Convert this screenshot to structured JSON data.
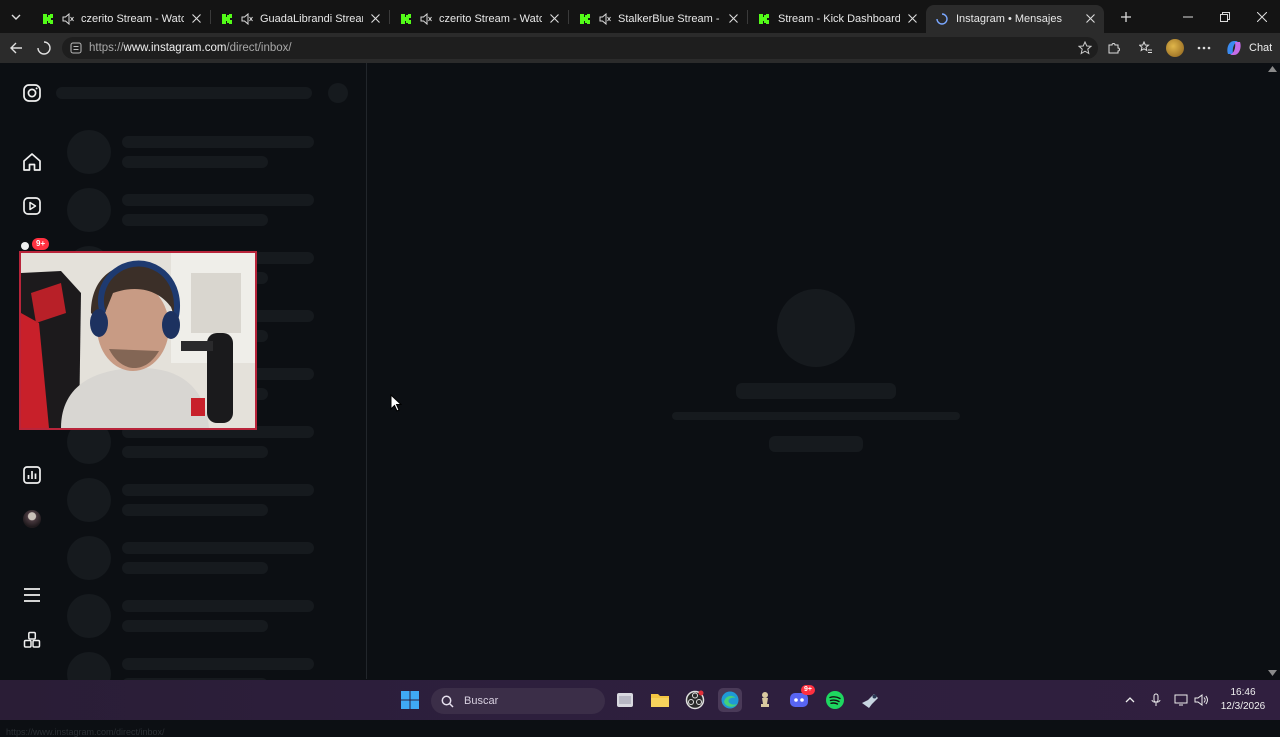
{
  "browser": {
    "tabs": [
      {
        "title": "czerito Stream - Watch Live",
        "favicon": "kick-logo-icon",
        "muted": true
      },
      {
        "title": "GuadaLibrandi Stream - Watch",
        "favicon": "kick-logo-icon",
        "muted": true
      },
      {
        "title": "czerito Stream - Watch Live",
        "favicon": "kick-logo-icon",
        "muted": true
      },
      {
        "title": "StalkerBlue Stream - Watch",
        "favicon": "kick-logo-icon",
        "muted": true
      },
      {
        "title": "Stream - Kick Dashboard",
        "favicon": "kick-logo-icon",
        "muted": false
      },
      {
        "title": "Instagram • Mensajes",
        "favicon": "loading-spinner-icon",
        "muted": false,
        "active": true
      }
    ],
    "address": {
      "prefix": "https://",
      "host": "www.instagram.com",
      "path": "/direct/inbox/"
    },
    "chat_label": "Chat",
    "status_url": "https://www.instagram.com/direct/inbox/"
  },
  "sidebar": {
    "notification_badge": "9+",
    "icons": [
      "instagram-logo-icon",
      "home-icon",
      "reels-icon",
      "messages-icon",
      "create-icon",
      "insights-icon",
      "profile-avatar",
      "menu-icon",
      "more-apps-icon"
    ]
  },
  "taskbar": {
    "search_placeholder": "Buscar",
    "time": "16:46",
    "date": "12/3/2026",
    "discord_badge": "9+"
  },
  "colors": {
    "page_bg": "#0c0f13",
    "skeleton": "#161a1e",
    "kick_green": "#53fc18",
    "badge_red": "#ff3040"
  }
}
